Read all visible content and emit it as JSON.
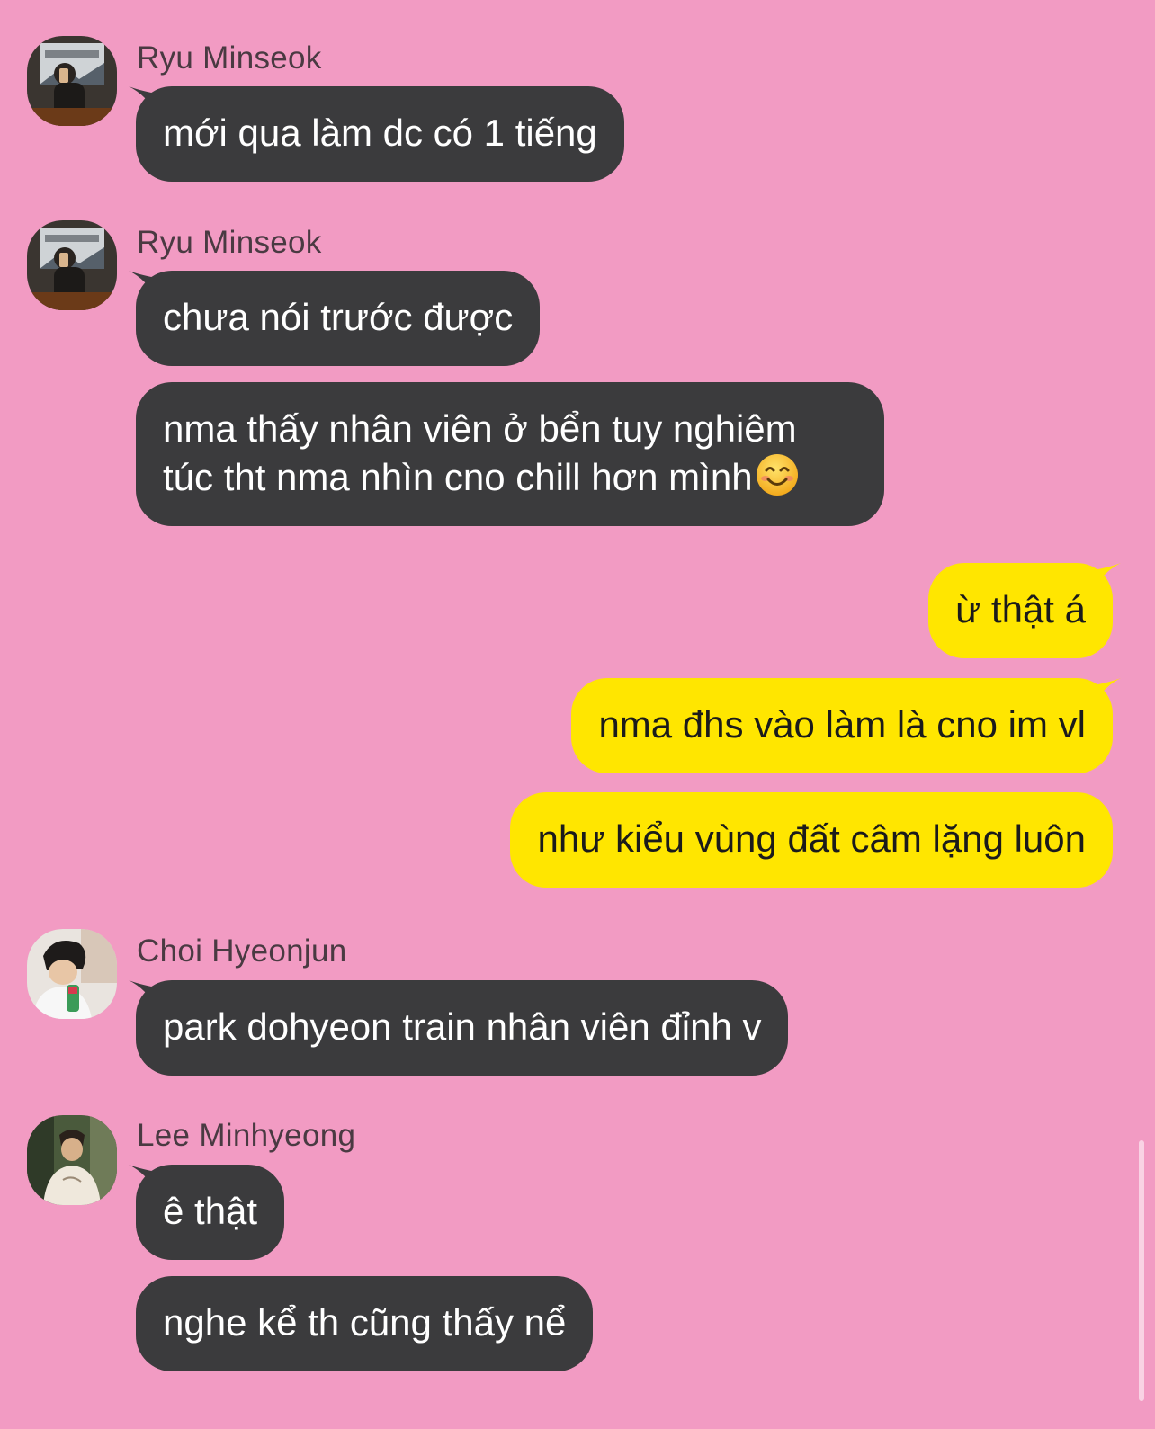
{
  "colors": {
    "background": "#f29bc3",
    "incoming_bubble": "#3b3b3d",
    "outgoing_bubble": "#ffe600"
  },
  "messages": [
    {
      "sender": "Ryu Minseok",
      "text": "mới qua làm dc có 1 tiếng"
    },
    {
      "sender": "Ryu Minseok",
      "text": "chưa nói trước được"
    },
    {
      "text_line1": "nma thấy nhân viên ở bển tuy nghiêm",
      "text_line2": "túc tht nma nhìn cno chill hơn mình",
      "emoji": "smiling-face-icon"
    },
    {
      "text": "ừ thật á"
    },
    {
      "text": "nma đhs vào làm là cno im vl"
    },
    {
      "text": "như kiểu vùng đất câm lặng luôn"
    },
    {
      "sender": "Choi Hyeonjun",
      "text": "park dohyeon train nhân viên đỉnh v"
    },
    {
      "sender": "Lee Minhyeong",
      "text": "ê thật"
    },
    {
      "text": "nghe kể th cũng thấy nể"
    }
  ]
}
